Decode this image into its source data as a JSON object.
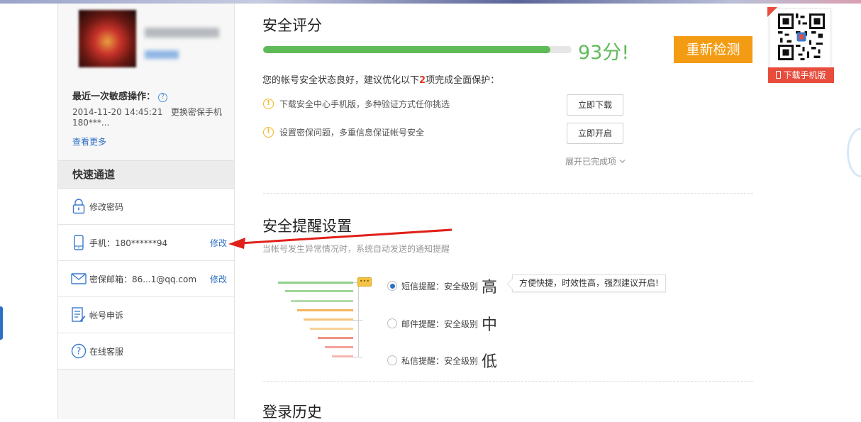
{
  "sidebar": {
    "recent_title": "最近一次敏感操作：",
    "help_glyph": "?",
    "recent_time": "2014-11-20 14:45:21",
    "recent_action": "更换密保手机",
    "recent_detail": "180***...",
    "see_more": "查看更多",
    "quick_title": "快速通道",
    "items": [
      {
        "label": "修改密码",
        "icon": "lock-icon",
        "action": ""
      },
      {
        "label": "手机：180******94",
        "icon": "mobile-phone-icon",
        "action": "修改"
      },
      {
        "label": "密保邮箱：86...1@qq.com",
        "icon": "mail-icon",
        "action": "修改"
      },
      {
        "label": "帐号申诉",
        "icon": "document-edit-icon",
        "action": ""
      },
      {
        "label": "在线客服",
        "icon": "question-circle-icon",
        "action": ""
      }
    ]
  },
  "security": {
    "title": "安全评分",
    "score_text": "93分!",
    "progress": 0.93,
    "recheck_label": "重新检测",
    "status_prefix": "您的帐号安全状态良好，建议优化以下",
    "status_count": "2",
    "status_suffix": "项完成全面保护：",
    "tips": [
      {
        "text": "下载安全中心手机版，多种验证方式任你挑选",
        "button": "立即下载"
      },
      {
        "text": "设置密保问题，多重信息保证帐号安全",
        "button": "立即开启"
      }
    ],
    "expand_label": "展开已完成项"
  },
  "reminder": {
    "title": "安全提醒设置",
    "subtitle": "当帐号发生异常情况时，系统自动发送的通知提醒",
    "options": [
      {
        "label": "短信提醒：安全级别",
        "level": "高",
        "selected": true
      },
      {
        "label": "邮件提醒：安全级别",
        "level": "中",
        "selected": false
      },
      {
        "label": "私信提醒：安全级别",
        "level": "低",
        "selected": false
      }
    ],
    "tooltip": "方便快捷，时效性高，强烈建议开启!"
  },
  "login_history": {
    "title": "登录历史"
  },
  "qr": {
    "badge": "下载手机版"
  },
  "colors": {
    "accent": "#f39c13",
    "score_green": "#5fba58",
    "link": "#2c6fc4",
    "arrow": "#e0201a"
  }
}
